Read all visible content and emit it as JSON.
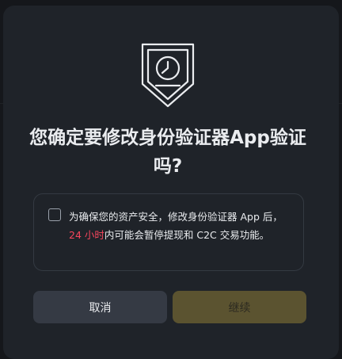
{
  "dialog": {
    "title": "您确定要修改身份验证器App验证吗?",
    "notice": {
      "text_before": "为确保您的资产安全，修改身份验证器 App 后，",
      "highlight": "24 小时",
      "text_after": "内可能会暂停提现和 C2C 交易功能。",
      "checkbox_checked": false
    },
    "buttons": {
      "cancel_label": "取消",
      "continue_label": "继续",
      "continue_disabled": true
    },
    "icon": "shield-clock-icon",
    "colors": {
      "background": "#15171b",
      "dialog": "#1f2329",
      "highlight": "#f6465d",
      "continue_disabled": "#5b5330",
      "cancel": "#353a44"
    }
  }
}
